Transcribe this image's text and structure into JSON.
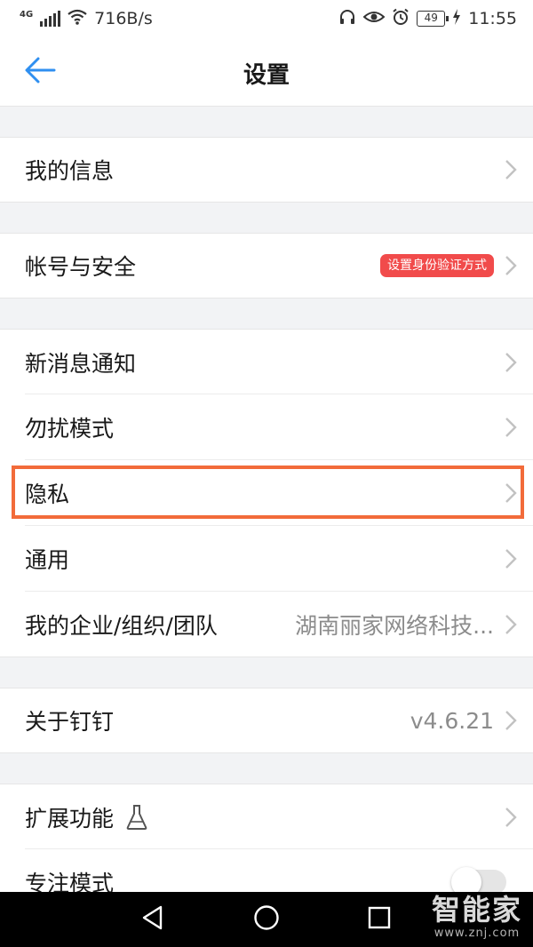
{
  "status_bar": {
    "network": "4G",
    "speed": "716B/s",
    "battery": "49",
    "time": "11:55",
    "icons": [
      "signal-icon",
      "wifi-icon",
      "headphones-icon",
      "eye-icon",
      "alarm-icon",
      "battery-icon",
      "charging-icon"
    ]
  },
  "nav": {
    "title": "设置",
    "back_icon": "back-arrow-icon",
    "accent": "#2f8ff0"
  },
  "settings": {
    "my_info": "我的信息",
    "account_security": "帐号与安全",
    "account_badge": "设置身份验证方式",
    "new_message": "新消息通知",
    "dnd": "勿扰模式",
    "privacy": "隐私",
    "general": "通用",
    "org_label": "我的企业/组织/团队",
    "org_value": "湖南丽家网络科技...",
    "about": "关于钉钉",
    "about_version": "v4.6.21",
    "extensions": "扩展功能",
    "focus_mode": "专注模式",
    "focus_mode_on": false
  },
  "colors": {
    "badge": "#f14b4b",
    "highlight": "#f26b3a"
  },
  "system_nav": {
    "icons": [
      "back-triangle-icon",
      "home-circle-icon",
      "recents-square-icon"
    ]
  },
  "watermark": {
    "logo_text": "智能家",
    "url": "www.znj.com"
  }
}
